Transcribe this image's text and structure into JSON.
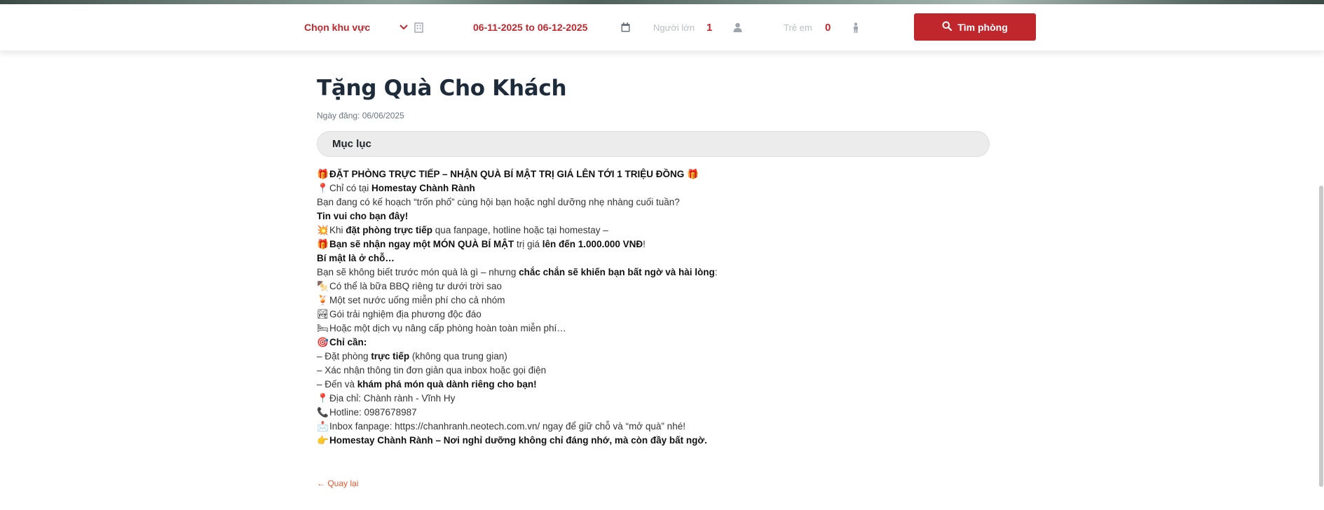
{
  "search": {
    "region_label": "Chọn khu vực",
    "date_range": "06-11-2025 to 06-12-2025",
    "adults_label": "Người lớn",
    "adults_value": "1",
    "children_label": "Trẻ em",
    "children_value": "0",
    "submit_label": "Tìm phòng"
  },
  "colors": {
    "accent": "#c0272d",
    "link": "#e4572e",
    "toc_bg": "#ececec"
  },
  "article": {
    "title": "Tặng Quà Cho Khách",
    "date_line": "Ngày đăng: 06/06/2025",
    "toc_label": "Mục lục",
    "l1": {
      "emoji": "🎁",
      "text": "ĐẶT PHÒNG TRỰC TIẾP – NHẬN QUÀ BÍ MẬT TRỊ GIÁ LÊN TỚI 1 TRIỆU ĐỒNG",
      "emoji_end": "🎁"
    },
    "l2": {
      "emoji": "📍",
      "pre": "Chỉ có tại ",
      "bold": "Homestay Chành Rành"
    },
    "l3": "Bạn đang có kế hoạch “trốn phố” cùng hội bạn hoặc nghỉ dưỡng nhẹ nhàng cuối tuần?",
    "l4": "Tin vui cho bạn đây!",
    "l5": {
      "emoji": "💥",
      "pre": "Khi ",
      "bold": "đặt phòng trực tiếp",
      "post": " qua fanpage, hotline hoặc tại homestay –"
    },
    "l6": {
      "emoji": "🎁",
      "bold1": "Bạn sẽ nhận ngay một MÓN QUÀ BÍ MẬT",
      "mid": " trị giá ",
      "bold2": "lên đến 1.000.000 VNĐ",
      "post": "!"
    },
    "l7": "Bí mật là ở chỗ…",
    "l8": {
      "pre": "Bạn sẽ không biết trước món quà là gì – nhưng ",
      "bold": "chắc chắn sẽ khiến bạn bất ngờ và hài lòng",
      "post": ":"
    },
    "l9": {
      "emoji": "🍢",
      "text": "Có thể là bữa BBQ riêng tư dưới trời sao"
    },
    "l10": {
      "emoji": "🍹",
      "text": "Một set nước uống miễn phí cho cả nhóm"
    },
    "l11": {
      "emoji": "🏞",
      "text": "Gói trải nghiệm địa phương độc đáo"
    },
    "l12": {
      "emoji": "🛏",
      "text": "Hoặc một dịch vụ nâng cấp phòng hoàn toàn miễn phí…"
    },
    "l13": {
      "emoji": "🎯",
      "bold": "Chỉ cần:"
    },
    "l14": {
      "pre": "– Đặt phòng ",
      "bold": "trực tiếp",
      "post": " (không qua trung gian)"
    },
    "l15": "– Xác nhận thông tin đơn giản qua inbox hoặc gọi điện",
    "l16": {
      "pre": "– Đến và ",
      "bold": "khám phá món quà dành riêng cho bạn!"
    },
    "l17": {
      "emoji": "📍",
      "text": "Địa chỉ: Chành rành - Vĩnh Hy"
    },
    "l18": {
      "emoji": "📞",
      "text": "Hotline: 0987678987"
    },
    "l19": {
      "emoji": "📩",
      "text": "Inbox fanpage: https://chanhranh.neotech.com.vn/ ngay để giữ chỗ và “mở quà” nhé!"
    },
    "l20": {
      "emoji": "👉",
      "text": "Homestay Chành Rành – Nơi nghỉ dưỡng không chỉ đáng nhớ, mà còn đầy bất ngờ."
    },
    "back_label": "← Quay lại"
  }
}
